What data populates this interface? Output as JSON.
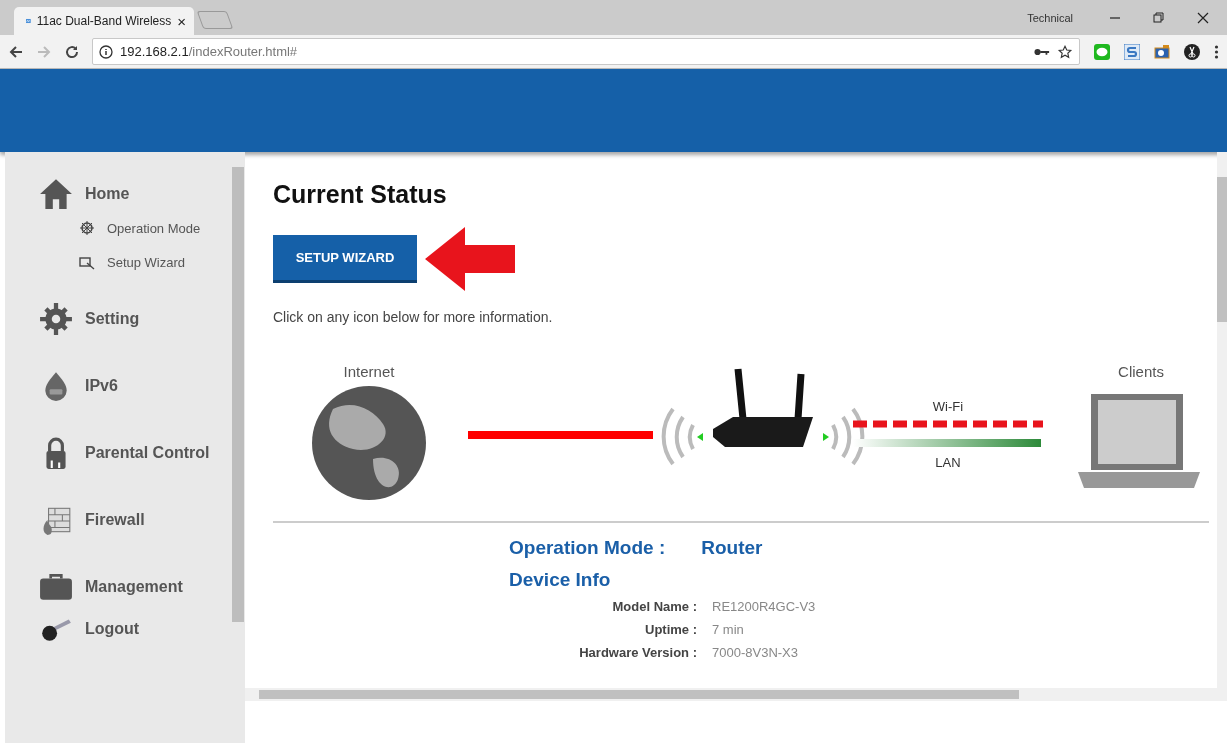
{
  "browser": {
    "tab_title": "11ac Dual-Band Wireless",
    "tab_close": "×",
    "profile": "Technical",
    "url_host": "192.168.2.1",
    "url_path": "/indexRouter.html#"
  },
  "sidebar": {
    "items": [
      {
        "label": "Home",
        "children": [
          {
            "label": "Operation Mode"
          },
          {
            "label": "Setup Wizard"
          }
        ]
      },
      {
        "label": "Setting"
      },
      {
        "label": "IPv6"
      },
      {
        "label": "Parental Control"
      },
      {
        "label": "Firewall"
      },
      {
        "label": "Management"
      },
      {
        "label": "Logout"
      }
    ]
  },
  "main": {
    "title": "Current Status",
    "wizard_button": "SETUP WIZARD",
    "hint": "Click on any icon below for more information.",
    "diagram": {
      "internet": "Internet",
      "wifi": "Wi-Fi",
      "lan": "LAN",
      "clients": "Clients"
    },
    "operation_mode_label": "Operation Mode :",
    "operation_mode_value": "Router",
    "device_info_title": "Device Info",
    "device_info": [
      {
        "label": "Model Name :",
        "value": "RE1200R4GC-V3"
      },
      {
        "label": "Uptime :",
        "value": "7 min"
      },
      {
        "label": "Hardware Version :",
        "value": "7000-8V3N-X3"
      }
    ]
  }
}
